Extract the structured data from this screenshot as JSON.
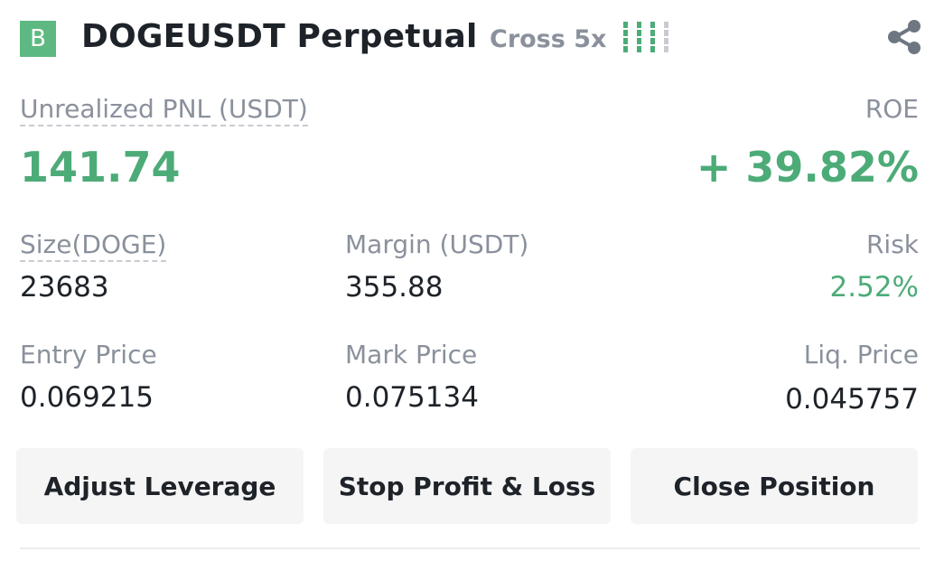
{
  "header": {
    "badge": "B",
    "symbol": "DOGEUSDT Perpetual",
    "margin_mode": "Cross 5x",
    "risk_level": 4,
    "risk_bar_colors": [
      "#4dab78",
      "#4dab78",
      "#4dab78",
      "#c8ccd2"
    ],
    "share_icon": "share-icon"
  },
  "pnl": {
    "label": "Unrealized PNL (USDT)",
    "value": "141.74"
  },
  "roe": {
    "label": "ROE",
    "value": "+ 39.82%"
  },
  "stats": {
    "size_label": "Size(DOGE)",
    "size_value": "23683",
    "margin_label": "Margin (USDT)",
    "margin_value": "355.88",
    "risk_label": "Risk",
    "risk_value": "2.52%",
    "entry_label": "Entry Price",
    "entry_value": "0.069215",
    "mark_label": "Mark Price",
    "mark_value": "0.075134",
    "liq_label": "Liq. Price",
    "liq_value": "0.045757"
  },
  "buttons": {
    "adjust_leverage": "Adjust Leverage",
    "stop_profit_loss": "Stop Profit & Loss",
    "close_position": "Close Position"
  },
  "colors": {
    "positive": "#4dab78",
    "badge": "#5db981",
    "muted": "#8a919c",
    "button_bg": "#f5f5f5"
  }
}
